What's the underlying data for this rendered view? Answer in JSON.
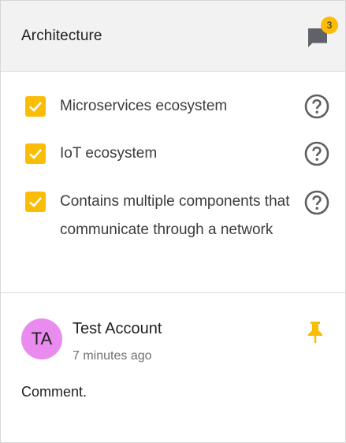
{
  "header": {
    "title": "Architecture",
    "comment_count": "3",
    "comment_icon": "comment-icon"
  },
  "checklist": {
    "items": [
      {
        "label": "Microservices ecosystem",
        "checked": true
      },
      {
        "label": "IoT ecosystem",
        "checked": true
      },
      {
        "label": "Contains multiple components that communicate through a network",
        "checked": true
      }
    ]
  },
  "comment": {
    "avatar_initials": "TA",
    "author": "Test Account",
    "time": "7 minutes ago",
    "text": "Comment.",
    "pinned": true
  },
  "colors": {
    "accent": "#fbbc05",
    "avatar": "#ea8bf0",
    "header_bg": "#f2f2f2"
  }
}
